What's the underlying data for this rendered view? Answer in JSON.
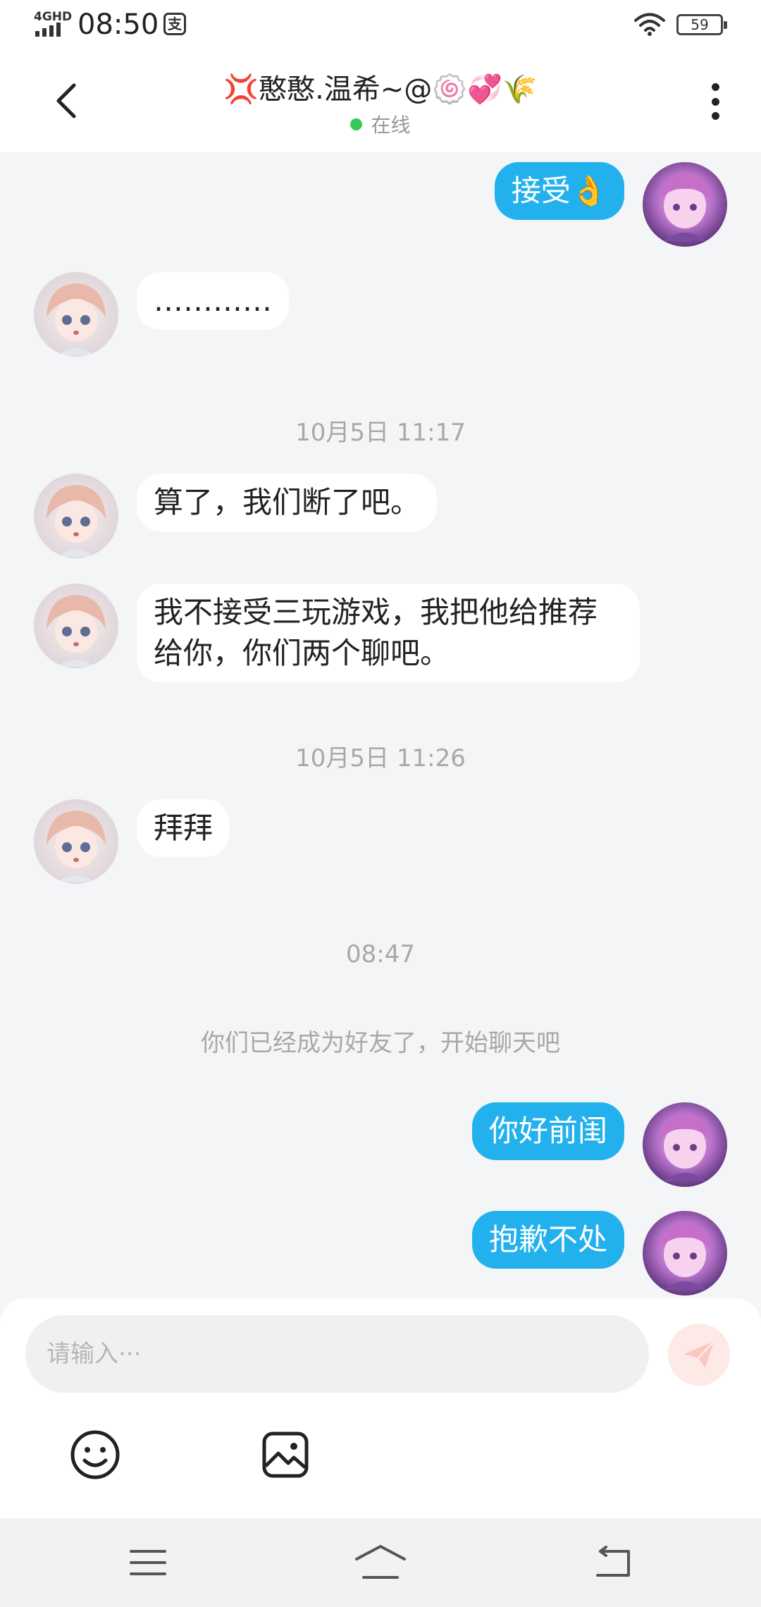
{
  "status_bar": {
    "network": "4GHD",
    "time": "08:50",
    "app_badge": "支",
    "battery": "59"
  },
  "header": {
    "title": "💢憨憨.温希~@🍥💞🌾",
    "status": "在线"
  },
  "messages": [
    {
      "type": "out",
      "text": "接受👌"
    },
    {
      "type": "in",
      "text": "…………"
    },
    {
      "type": "time",
      "text": "10月5日 11:17"
    },
    {
      "type": "in",
      "text": "算了，我们断了吧。"
    },
    {
      "type": "in",
      "text": "我不接受三玩游戏，我把他给推荐给你，你们两个聊吧。"
    },
    {
      "type": "time",
      "text": "10月5日 11:26"
    },
    {
      "type": "in",
      "text": "拜拜"
    },
    {
      "type": "time",
      "text": "08:47"
    },
    {
      "type": "system",
      "text": "你们已经成为好友了，开始聊天吧"
    },
    {
      "type": "out",
      "text": "你好前闺"
    },
    {
      "type": "out",
      "text": "抱歉不处"
    }
  ],
  "input": {
    "placeholder": "请输入···"
  },
  "icons": {
    "back": "chevron-left-icon",
    "more": "more-vertical-icon",
    "send": "send-icon",
    "emoji": "emoji-icon",
    "image": "image-icon",
    "menu": "menu-icon",
    "home": "home-icon",
    "return": "return-icon"
  },
  "colors": {
    "outgoing_bubble": "#23b1ee",
    "incoming_bubble": "#ffffff",
    "online": "#35c957",
    "chat_background": "#f4f5f7"
  }
}
